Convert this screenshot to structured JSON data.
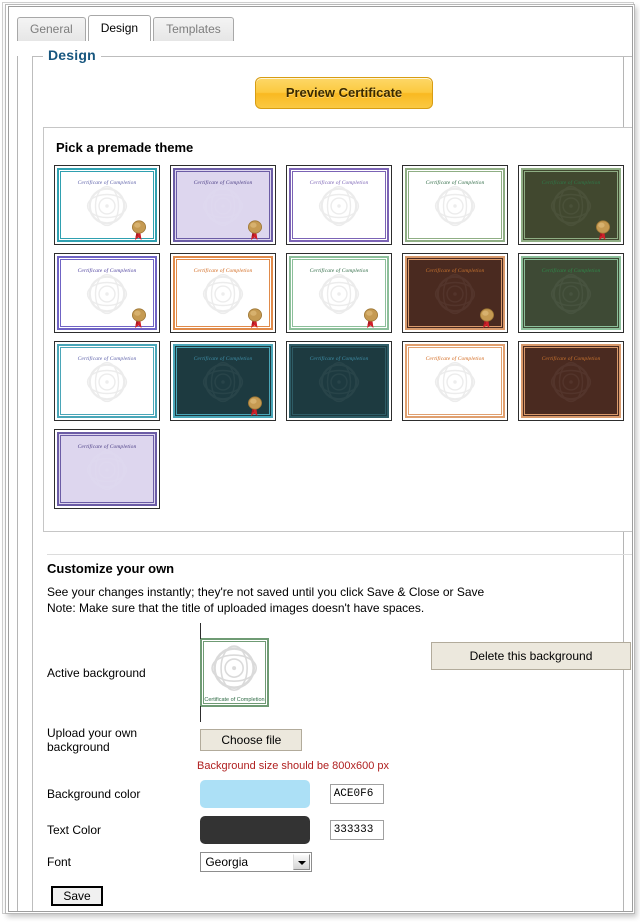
{
  "tabs": [
    {
      "label": "General",
      "active": false
    },
    {
      "label": "Design",
      "active": true
    },
    {
      "label": "Templates",
      "active": false
    }
  ],
  "fieldset": {
    "legend": "Design"
  },
  "preview": {
    "button_label": "Preview Certificate"
  },
  "themes": {
    "heading": "Pick a premade theme",
    "cert_title": "Certificate of Completion",
    "rows": [
      [
        {
          "name": "teal-border-white",
          "border": "#2fa0b0",
          "bg": "#ffffff",
          "title_color": "#5b5fa8",
          "seal": true
        },
        {
          "name": "purple-filled",
          "border": "#6b5ca5",
          "bg": "#ddd6ee",
          "title_color": "#4a3d84",
          "seal": true
        },
        {
          "name": "violet-border-white",
          "border": "#7b63b5",
          "bg": "#ffffff",
          "title_color": "#7b63b5",
          "seal": false
        },
        {
          "name": "green-border-white",
          "border": "#8fae84",
          "bg": "#ffffff",
          "title_color": "#2f6b45",
          "seal": false
        },
        {
          "name": "dark-olive-filled",
          "border": "#8fae84",
          "bg": "#41482f",
          "title_color": "#2f7a4a",
          "seal": true
        }
      ],
      [
        {
          "name": "blueviolet-border-white",
          "border": "#6f63c4",
          "bg": "#ffffff",
          "title_color": "#4a3d9c",
          "seal": true
        },
        {
          "name": "orange-border-white",
          "border": "#e08a4a",
          "bg": "#ffffff",
          "title_color": "#d2691e",
          "seal": true
        },
        {
          "name": "green-border-white-2",
          "border": "#8cbf9a",
          "bg": "#ffffff",
          "title_color": "#2f6b45",
          "seal": true
        },
        {
          "name": "brown-filled",
          "border": "#d99a6c",
          "bg": "#4a2a20",
          "title_color": "#c9742f",
          "seal": true
        },
        {
          "name": "dark-green-filled",
          "border": "#8cbf9a",
          "bg": "#3e4a35",
          "title_color": "#2f8a4a",
          "seal": false
        }
      ],
      [
        {
          "name": "teal-border-white-2",
          "border": "#4aa6b8",
          "bg": "#ffffff",
          "title_color": "#5b5fa8",
          "seal": false
        },
        {
          "name": "dark-teal-filled",
          "border": "#4aa6b8",
          "bg": "#1d3a40",
          "title_color": "#3f8fa8",
          "seal": true
        },
        {
          "name": "dark-teal-filled-2",
          "border": "#2e5c66",
          "bg": "#1d3a40",
          "title_color": "#3f8fa8",
          "seal": false
        },
        {
          "name": "orange-border-white-2",
          "border": "#e0a070",
          "bg": "#ffffff",
          "title_color": "#d2691e",
          "seal": false
        },
        {
          "name": "brown-filled-2",
          "border": "#d99a6c",
          "bg": "#4a2a20",
          "title_color": "#c9742f",
          "seal": false
        }
      ],
      [
        {
          "name": "lavender-filled",
          "border": "#6b5ca5",
          "bg": "#ddd6ee",
          "title_color": "#4a3d84",
          "seal": false
        }
      ]
    ]
  },
  "customize": {
    "heading": "Customize your own",
    "note_line_1": "See your changes instantly; they're not saved until you click Save & Close or Save",
    "note_line_2": "Note: Make sure that the title of uploaded images doesn't have spaces.",
    "active_background_label": "Active background",
    "active_background_theme": {
      "border": "#6f9b74",
      "bg": "#ffffff",
      "title_color": "#2f6b45"
    },
    "delete_background_label": "Delete this background",
    "upload_label": "Upload your own background",
    "choose_file_label": "Choose file",
    "bg_size_note": "Background size should be 800x600 px",
    "background_color_label": "Background color",
    "background_color_hex": "ACE0F6",
    "background_color_value": "#ACE0F6",
    "text_color_label": "Text Color",
    "text_color_hex": "333333",
    "text_color_value": "#333333",
    "font_label": "Font",
    "font_value": "Georgia",
    "save_label": "Save"
  }
}
